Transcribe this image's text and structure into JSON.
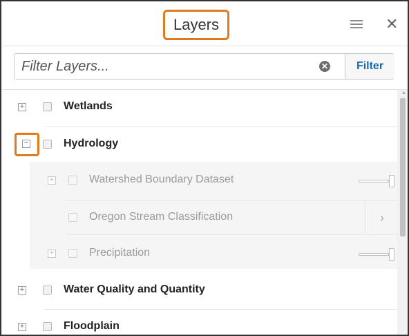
{
  "header": {
    "title": "Layers"
  },
  "filter": {
    "placeholder": "Filter Layers...",
    "value": "",
    "button_label": "Filter"
  },
  "icons": {
    "expand": "+",
    "collapse": "−",
    "clear": "✕",
    "close": "✕",
    "chevron": "›"
  },
  "layers": {
    "wetlands": {
      "label": "Wetlands",
      "expanded": false,
      "checked": false
    },
    "hydrology": {
      "label": "Hydrology",
      "expanded": true,
      "checked": false,
      "children": {
        "watershed": {
          "label": "Watershed Boundary Dataset",
          "checked": false
        },
        "oregon_stream": {
          "label": "Oregon Stream Classification",
          "checked": false
        },
        "precipitation": {
          "label": "Precipitation",
          "checked": false
        }
      }
    },
    "water_quality": {
      "label": "Water Quality and Quantity",
      "expanded": false,
      "checked": false
    },
    "floodplain": {
      "label": "Floodplain",
      "expanded": false,
      "checked": false
    }
  },
  "colors": {
    "highlight": "#e07a1f",
    "accent": "#1a6aa8"
  }
}
